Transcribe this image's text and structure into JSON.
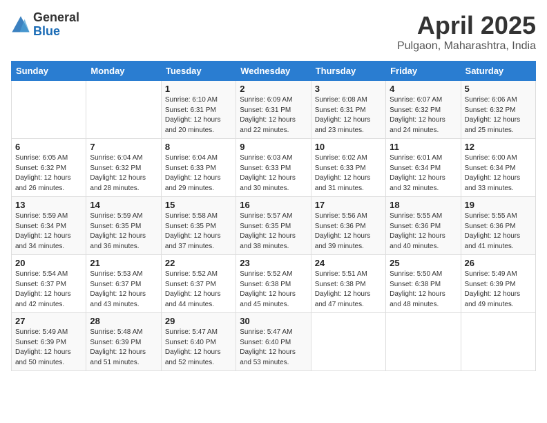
{
  "logo": {
    "general": "General",
    "blue": "Blue"
  },
  "title": {
    "month": "April 2025",
    "location": "Pulgaon, Maharashtra, India"
  },
  "days_of_week": [
    "Sunday",
    "Monday",
    "Tuesday",
    "Wednesday",
    "Thursday",
    "Friday",
    "Saturday"
  ],
  "weeks": [
    [
      {
        "day": "",
        "info": ""
      },
      {
        "day": "",
        "info": ""
      },
      {
        "day": "1",
        "info": "Sunrise: 6:10 AM\nSunset: 6:31 PM\nDaylight: 12 hours and 20 minutes."
      },
      {
        "day": "2",
        "info": "Sunrise: 6:09 AM\nSunset: 6:31 PM\nDaylight: 12 hours and 22 minutes."
      },
      {
        "day": "3",
        "info": "Sunrise: 6:08 AM\nSunset: 6:31 PM\nDaylight: 12 hours and 23 minutes."
      },
      {
        "day": "4",
        "info": "Sunrise: 6:07 AM\nSunset: 6:32 PM\nDaylight: 12 hours and 24 minutes."
      },
      {
        "day": "5",
        "info": "Sunrise: 6:06 AM\nSunset: 6:32 PM\nDaylight: 12 hours and 25 minutes."
      }
    ],
    [
      {
        "day": "6",
        "info": "Sunrise: 6:05 AM\nSunset: 6:32 PM\nDaylight: 12 hours and 26 minutes."
      },
      {
        "day": "7",
        "info": "Sunrise: 6:04 AM\nSunset: 6:32 PM\nDaylight: 12 hours and 28 minutes."
      },
      {
        "day": "8",
        "info": "Sunrise: 6:04 AM\nSunset: 6:33 PM\nDaylight: 12 hours and 29 minutes."
      },
      {
        "day": "9",
        "info": "Sunrise: 6:03 AM\nSunset: 6:33 PM\nDaylight: 12 hours and 30 minutes."
      },
      {
        "day": "10",
        "info": "Sunrise: 6:02 AM\nSunset: 6:33 PM\nDaylight: 12 hours and 31 minutes."
      },
      {
        "day": "11",
        "info": "Sunrise: 6:01 AM\nSunset: 6:34 PM\nDaylight: 12 hours and 32 minutes."
      },
      {
        "day": "12",
        "info": "Sunrise: 6:00 AM\nSunset: 6:34 PM\nDaylight: 12 hours and 33 minutes."
      }
    ],
    [
      {
        "day": "13",
        "info": "Sunrise: 5:59 AM\nSunset: 6:34 PM\nDaylight: 12 hours and 34 minutes."
      },
      {
        "day": "14",
        "info": "Sunrise: 5:59 AM\nSunset: 6:35 PM\nDaylight: 12 hours and 36 minutes."
      },
      {
        "day": "15",
        "info": "Sunrise: 5:58 AM\nSunset: 6:35 PM\nDaylight: 12 hours and 37 minutes."
      },
      {
        "day": "16",
        "info": "Sunrise: 5:57 AM\nSunset: 6:35 PM\nDaylight: 12 hours and 38 minutes."
      },
      {
        "day": "17",
        "info": "Sunrise: 5:56 AM\nSunset: 6:36 PM\nDaylight: 12 hours and 39 minutes."
      },
      {
        "day": "18",
        "info": "Sunrise: 5:55 AM\nSunset: 6:36 PM\nDaylight: 12 hours and 40 minutes."
      },
      {
        "day": "19",
        "info": "Sunrise: 5:55 AM\nSunset: 6:36 PM\nDaylight: 12 hours and 41 minutes."
      }
    ],
    [
      {
        "day": "20",
        "info": "Sunrise: 5:54 AM\nSunset: 6:37 PM\nDaylight: 12 hours and 42 minutes."
      },
      {
        "day": "21",
        "info": "Sunrise: 5:53 AM\nSunset: 6:37 PM\nDaylight: 12 hours and 43 minutes."
      },
      {
        "day": "22",
        "info": "Sunrise: 5:52 AM\nSunset: 6:37 PM\nDaylight: 12 hours and 44 minutes."
      },
      {
        "day": "23",
        "info": "Sunrise: 5:52 AM\nSunset: 6:38 PM\nDaylight: 12 hours and 45 minutes."
      },
      {
        "day": "24",
        "info": "Sunrise: 5:51 AM\nSunset: 6:38 PM\nDaylight: 12 hours and 47 minutes."
      },
      {
        "day": "25",
        "info": "Sunrise: 5:50 AM\nSunset: 6:38 PM\nDaylight: 12 hours and 48 minutes."
      },
      {
        "day": "26",
        "info": "Sunrise: 5:49 AM\nSunset: 6:39 PM\nDaylight: 12 hours and 49 minutes."
      }
    ],
    [
      {
        "day": "27",
        "info": "Sunrise: 5:49 AM\nSunset: 6:39 PM\nDaylight: 12 hours and 50 minutes."
      },
      {
        "day": "28",
        "info": "Sunrise: 5:48 AM\nSunset: 6:39 PM\nDaylight: 12 hours and 51 minutes."
      },
      {
        "day": "29",
        "info": "Sunrise: 5:47 AM\nSunset: 6:40 PM\nDaylight: 12 hours and 52 minutes."
      },
      {
        "day": "30",
        "info": "Sunrise: 5:47 AM\nSunset: 6:40 PM\nDaylight: 12 hours and 53 minutes."
      },
      {
        "day": "",
        "info": ""
      },
      {
        "day": "",
        "info": ""
      },
      {
        "day": "",
        "info": ""
      }
    ]
  ]
}
